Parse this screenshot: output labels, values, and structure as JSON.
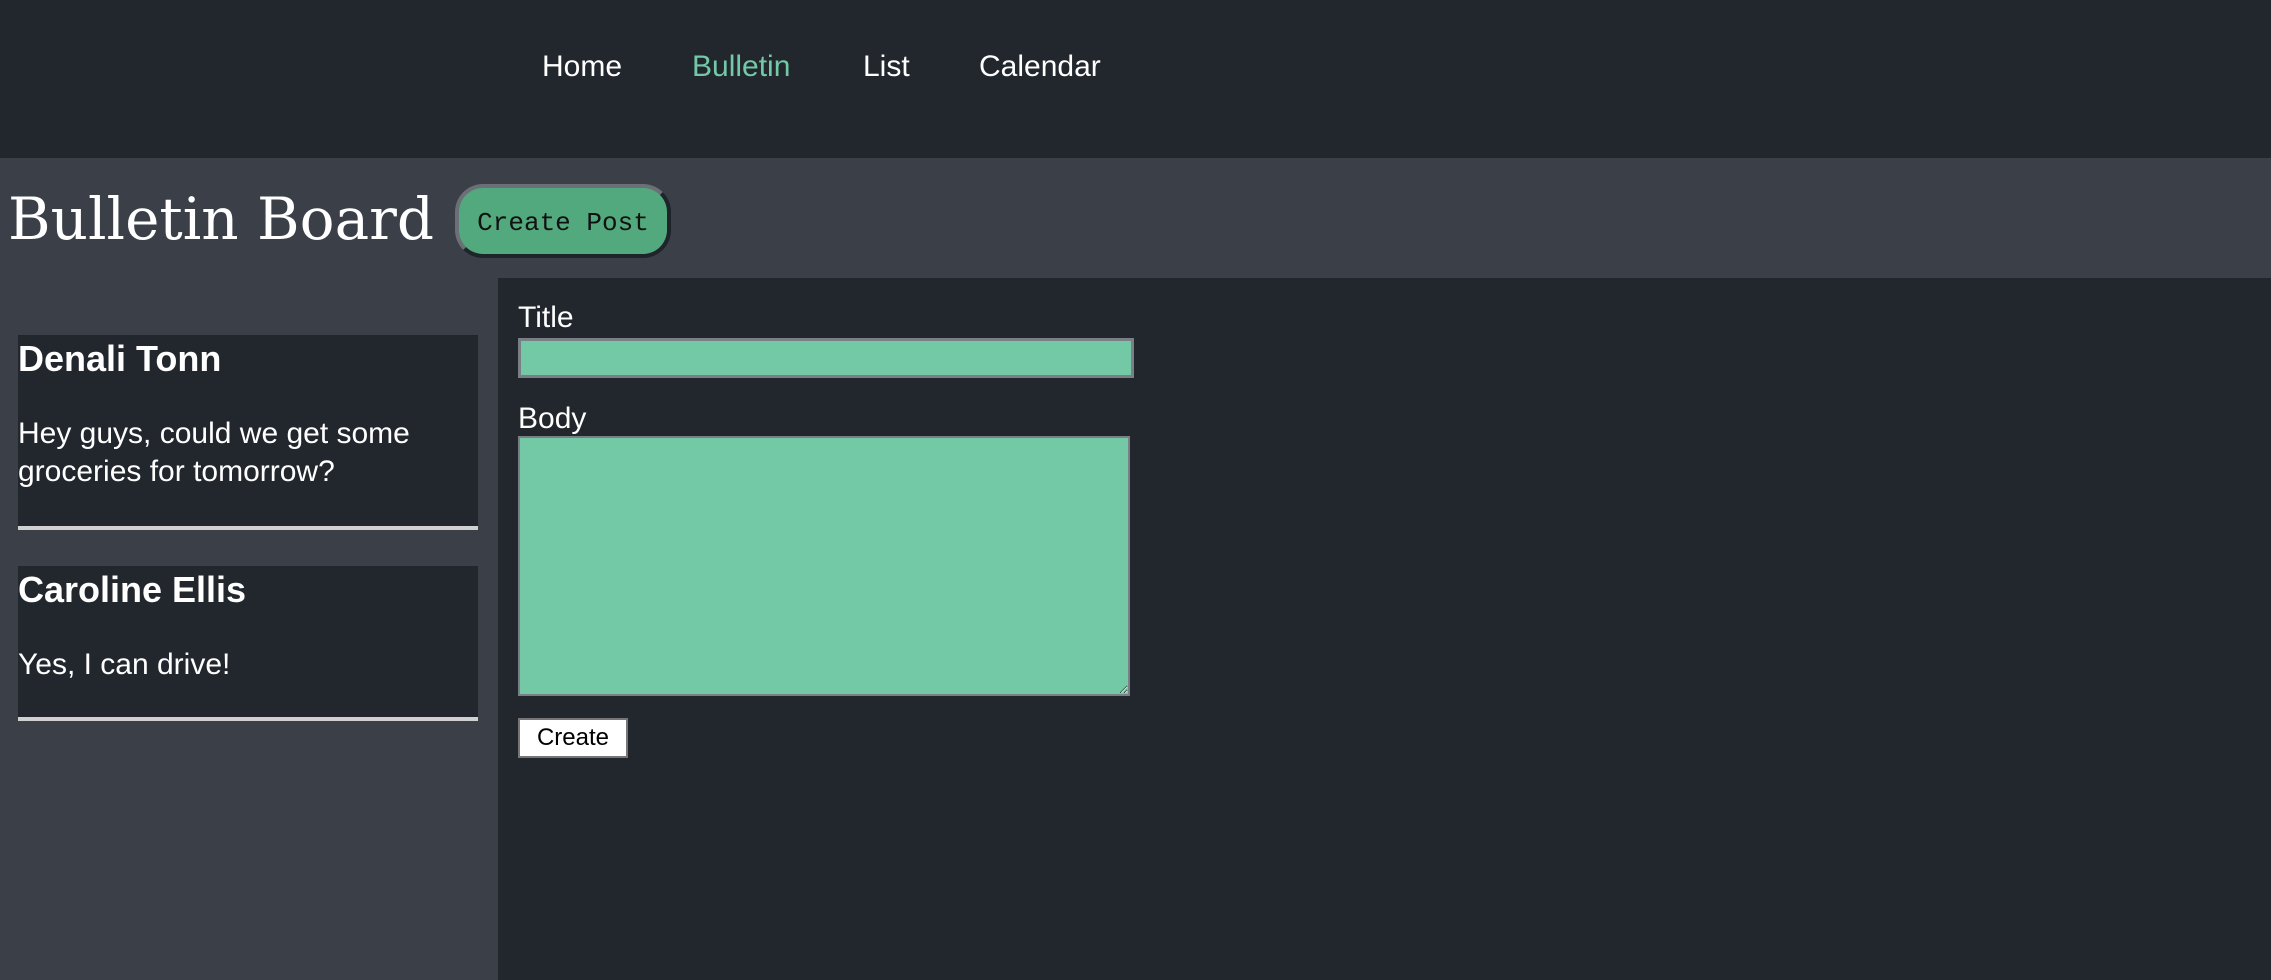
{
  "nav": {
    "items": [
      {
        "label": "Home",
        "active": false
      },
      {
        "label": "Bulletin",
        "active": true
      },
      {
        "label": "List",
        "active": false
      },
      {
        "label": "Calendar",
        "active": false
      }
    ]
  },
  "header": {
    "title": "Bulletin Board",
    "create_post_label": "Create Post"
  },
  "posts": [
    {
      "author": "Denali Tonn",
      "body": "Hey guys, could we get some groceries for tomorrow?"
    },
    {
      "author": "Caroline Ellis",
      "body": "Yes, I can drive!"
    }
  ],
  "form": {
    "title_label": "Title",
    "title_value": "",
    "body_label": "Body",
    "body_value": "",
    "submit_label": "Create"
  },
  "colors": {
    "accent": "#73c9a6",
    "button_green": "#52a97d",
    "dark_bg": "#22272e",
    "panel_bg": "#3a3f48"
  }
}
